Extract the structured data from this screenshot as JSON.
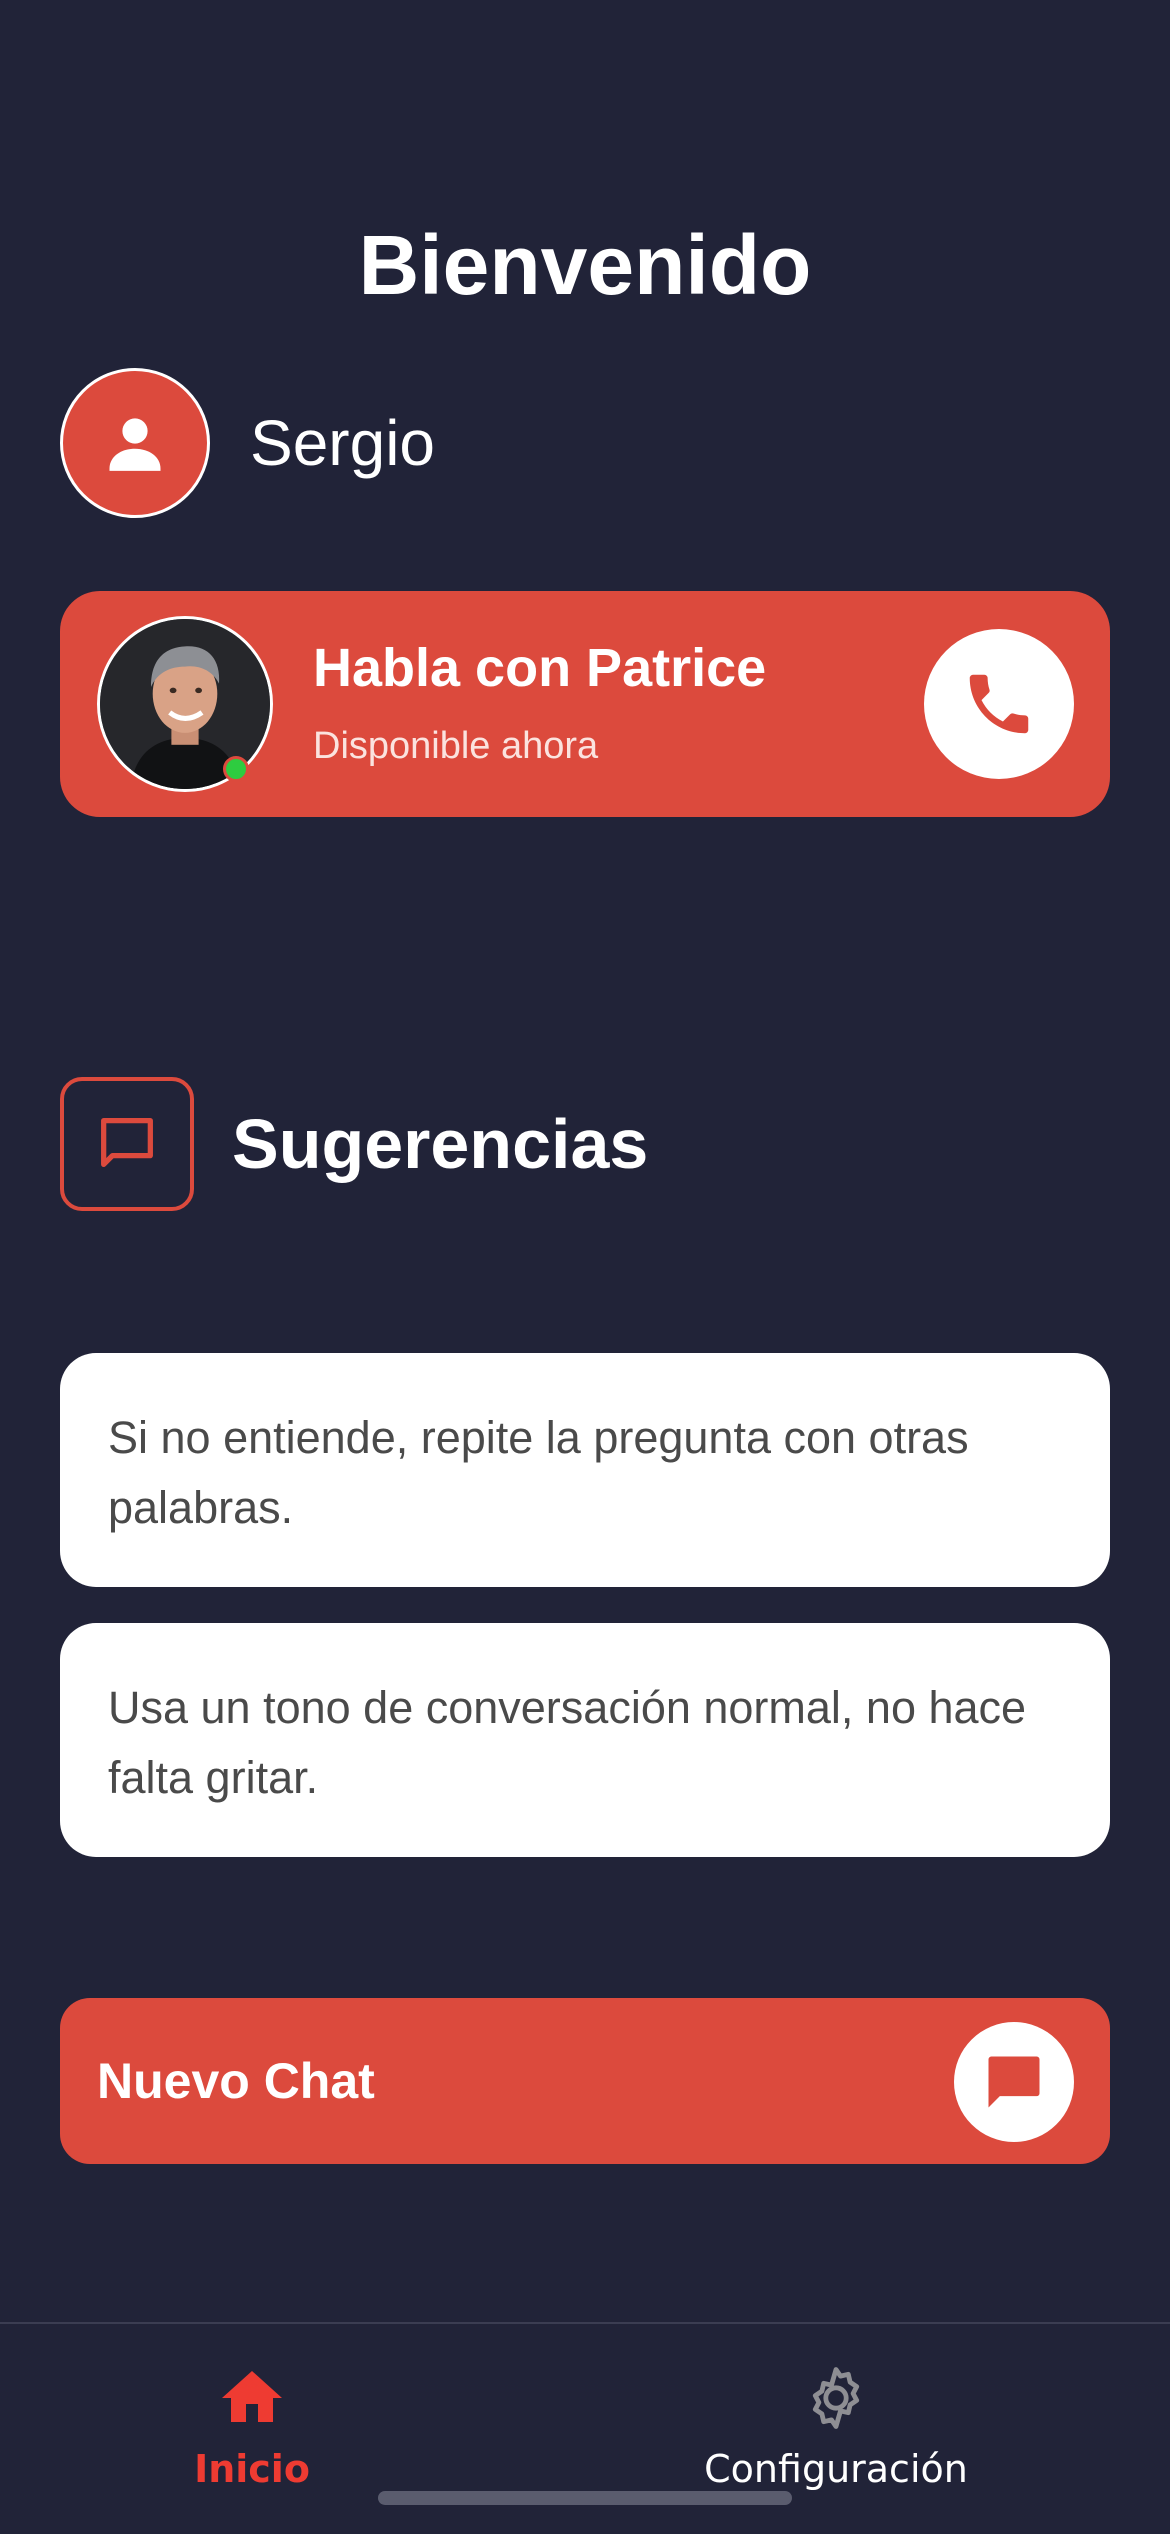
{
  "header": {
    "title": "Bienvenido"
  },
  "user": {
    "name": "Sergio",
    "avatar_icon": "person-icon"
  },
  "call_card": {
    "title": "Habla con Patrice",
    "status": "Disponible ahora",
    "online": true,
    "call_icon": "phone-icon",
    "accent_color": "#dc4a3d"
  },
  "suggestions": {
    "title": "Sugerencias",
    "icon": "chat-bubble-outline-icon",
    "items": [
      {
        "text": "Si no entiende, repite la pregunta con otras palabras."
      },
      {
        "text": "Usa un tono de conversación normal, no hace falta gritar."
      }
    ]
  },
  "new_chat": {
    "label": "Nuevo Chat",
    "icon": "chat-bubble-icon"
  },
  "tab_bar": {
    "active": "Inicio",
    "tabs": [
      {
        "label": "Inicio",
        "icon": "home-icon"
      },
      {
        "label": "Configuración",
        "icon": "gear-icon"
      }
    ]
  },
  "colors": {
    "background": "#212338",
    "accent": "#dc4a3d",
    "active_tab": "#ee3b32",
    "card": "#ffffff"
  }
}
